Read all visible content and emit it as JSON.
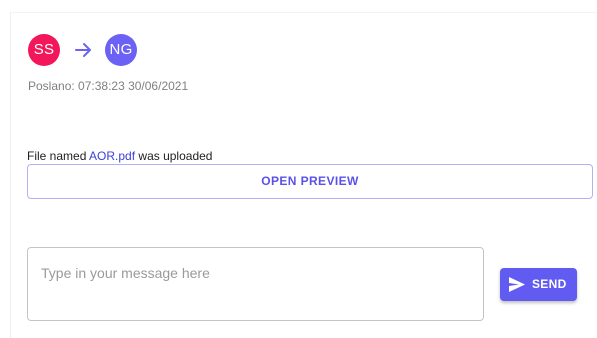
{
  "header": {
    "from_initials": "SS",
    "to_initials": "NG",
    "arrow_icon": "arrow-right-icon",
    "sent_label": "Poslano: 07:38:23 30/06/2021"
  },
  "attachment": {
    "prefix": "File named ",
    "file_name": "AOR.pdf",
    "suffix": " was uploaded",
    "preview_label": "OPEN PREVIEW"
  },
  "composer": {
    "placeholder": "Type in your message here",
    "value": "",
    "send_label": "SEND",
    "send_icon": "send-icon"
  },
  "colors": {
    "from_avatar": "#f2165a",
    "to_avatar": "#6b62f5",
    "accent": "#625bf2",
    "link": "#3b3fd6"
  }
}
